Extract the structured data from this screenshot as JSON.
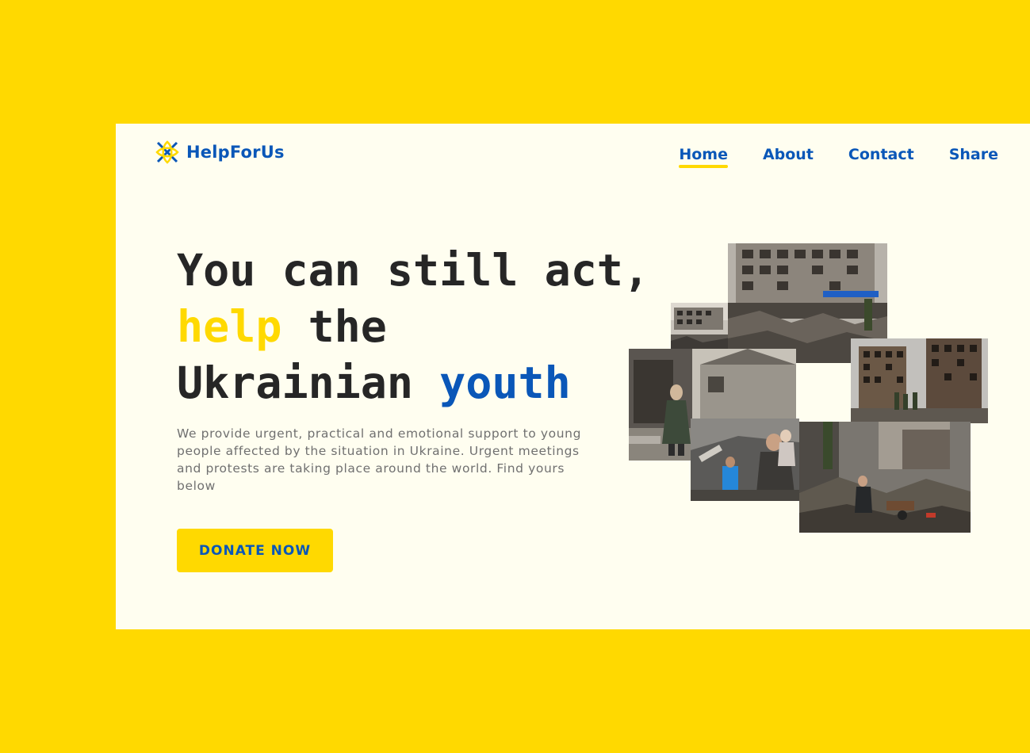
{
  "brand": {
    "name": "HelpForUs",
    "logo_icon": "ukraine-star-icon"
  },
  "nav": {
    "items": [
      {
        "label": "Home",
        "active": true
      },
      {
        "label": "About",
        "active": false
      },
      {
        "label": "Contact",
        "active": false
      },
      {
        "label": "Share",
        "active": false
      }
    ]
  },
  "hero": {
    "line1": "You can still act,",
    "line2_highlight": "help",
    "line2_rest": " the",
    "line3_start": "Ukrainian ",
    "line3_highlight": "youth",
    "description": "We provide urgent, practical and emotional support to young people affected by the situation in Ukraine. Urgent meetings and protests are taking place around the world. Find yours below",
    "cta_label": "DONATE NOW"
  },
  "colors": {
    "yellow": "#FFD900",
    "blue": "#0A57B8",
    "dark": "#262626",
    "card": "#FFFEF0"
  }
}
